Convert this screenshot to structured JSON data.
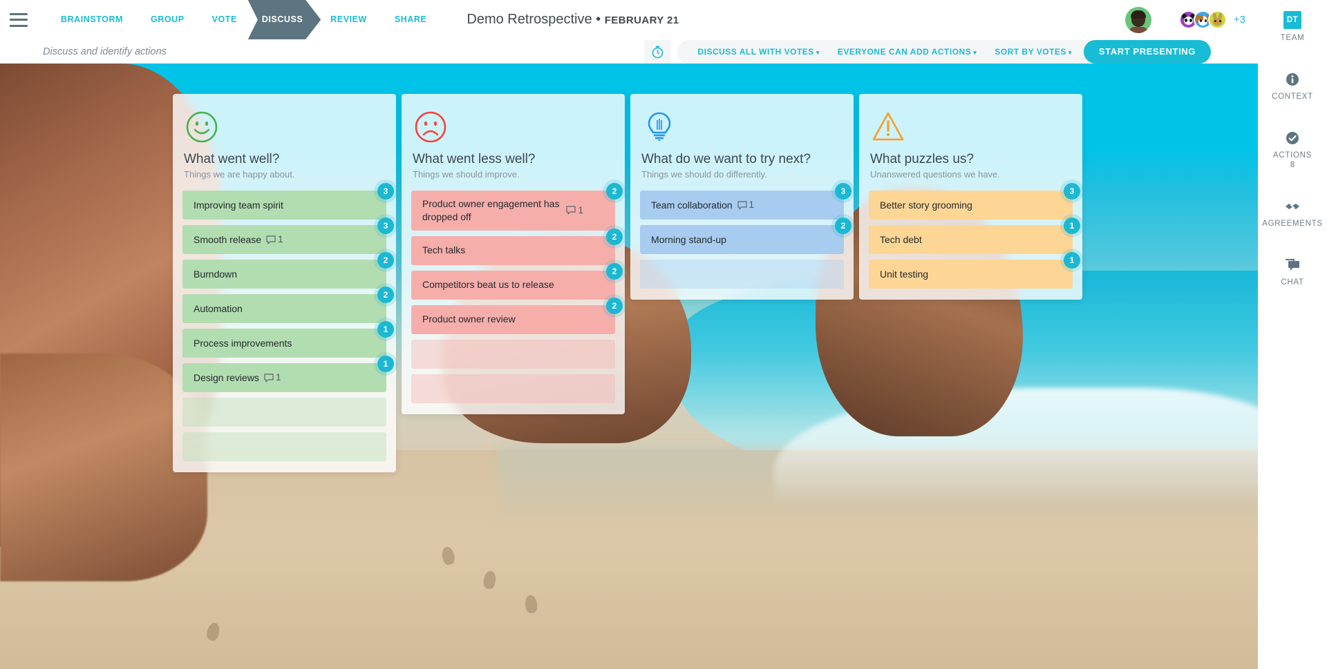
{
  "header": {
    "menu_icon": "hamburger-icon",
    "phases": [
      {
        "label": "BRAINSTORM",
        "active": false
      },
      {
        "label": "GROUP",
        "active": false
      },
      {
        "label": "VOTE",
        "active": false
      },
      {
        "label": "DISCUSS",
        "active": true
      },
      {
        "label": "REVIEW",
        "active": false
      },
      {
        "label": "SHARE",
        "active": false
      }
    ],
    "board_name": "Demo Retrospective • ",
    "board_date": "FEBRUARY 21",
    "participants_more": "+3"
  },
  "subheader": {
    "caption": "Discuss and identify actions",
    "timer_icon": "stopwatch-icon",
    "tools": [
      {
        "label": "DISCUSS ALL WITH VOTES",
        "caret": "▾"
      },
      {
        "label": "EVERYONE CAN ADD ACTIONS",
        "caret": "▾"
      },
      {
        "label": "SORT BY VOTES",
        "caret": "▾"
      }
    ],
    "start_button": "START PRESENTING"
  },
  "columns": [
    {
      "key": "went-well",
      "icon": "smiley-happy-icon",
      "title": "What went well?",
      "subtitle": "Things we are happy about.",
      "accent": "#4caf50",
      "cards": [
        {
          "text": "Improving team spirit",
          "votes": "3",
          "comments": null
        },
        {
          "text": "Smooth release",
          "votes": "3",
          "comments": "1"
        },
        {
          "text": "Burndown",
          "votes": "2",
          "comments": null
        },
        {
          "text": "Automation",
          "votes": "2",
          "comments": null
        },
        {
          "text": "Process improvements",
          "votes": "1",
          "comments": null
        },
        {
          "text": "Design reviews",
          "votes": "1",
          "comments": "1"
        },
        {
          "text": "",
          "votes": null,
          "comments": null
        },
        {
          "text": "",
          "votes": null,
          "comments": null
        }
      ]
    },
    {
      "key": "went-less-well",
      "icon": "smiley-sad-icon",
      "title": "What went less well?",
      "subtitle": "Things we should improve.",
      "accent": "#f4433c",
      "cards": [
        {
          "text": "Product owner engagement has dropped off",
          "votes": "2",
          "comments": "1"
        },
        {
          "text": "Tech talks",
          "votes": "2",
          "comments": null
        },
        {
          "text": "Competitors beat us to release",
          "votes": "2",
          "comments": null
        },
        {
          "text": "Product owner review",
          "votes": "2",
          "comments": null
        },
        {
          "text": "",
          "votes": null,
          "comments": null
        },
        {
          "text": "",
          "votes": null,
          "comments": null
        }
      ]
    },
    {
      "key": "try-next",
      "icon": "lightbulb-icon",
      "title": "What do we want to try next?",
      "subtitle": "Things we should do differently.",
      "accent": "#2196f3",
      "cards": [
        {
          "text": "Team collaboration",
          "votes": "3",
          "comments": "1"
        },
        {
          "text": "Morning stand-up",
          "votes": "2",
          "comments": null
        },
        {
          "text": "",
          "votes": null,
          "comments": null
        }
      ]
    },
    {
      "key": "puzzles",
      "icon": "warning-triangle-icon",
      "title": "What puzzles us?",
      "subtitle": "Unanswered questions we have.",
      "accent": "#f7a233",
      "cards": [
        {
          "text": "Better story grooming",
          "votes": "3",
          "comments": null
        },
        {
          "text": "Tech debt",
          "votes": "1",
          "comments": null
        },
        {
          "text": "Unit testing",
          "votes": "1",
          "comments": null
        }
      ]
    }
  ],
  "sidebar": {
    "items": [
      {
        "key": "team",
        "label": "TEAM",
        "icon": "team-initials-badge",
        "badge_text": "DT",
        "count": null
      },
      {
        "key": "context",
        "label": "CONTEXT",
        "icon": "info-circle-icon",
        "count": null
      },
      {
        "key": "actions",
        "label": "ACTIONS",
        "icon": "check-circle-icon",
        "count": "8"
      },
      {
        "key": "agreements",
        "label": "AGREEMENTS",
        "icon": "handshake-icon",
        "count": null
      },
      {
        "key": "chat",
        "label": "CHAT",
        "icon": "chat-bubble-icon",
        "count": null
      }
    ]
  },
  "colors": {
    "accent": "#18bcd4",
    "active_phase_bg": "#5d7580",
    "vote_badge": "#1cb8d3"
  }
}
